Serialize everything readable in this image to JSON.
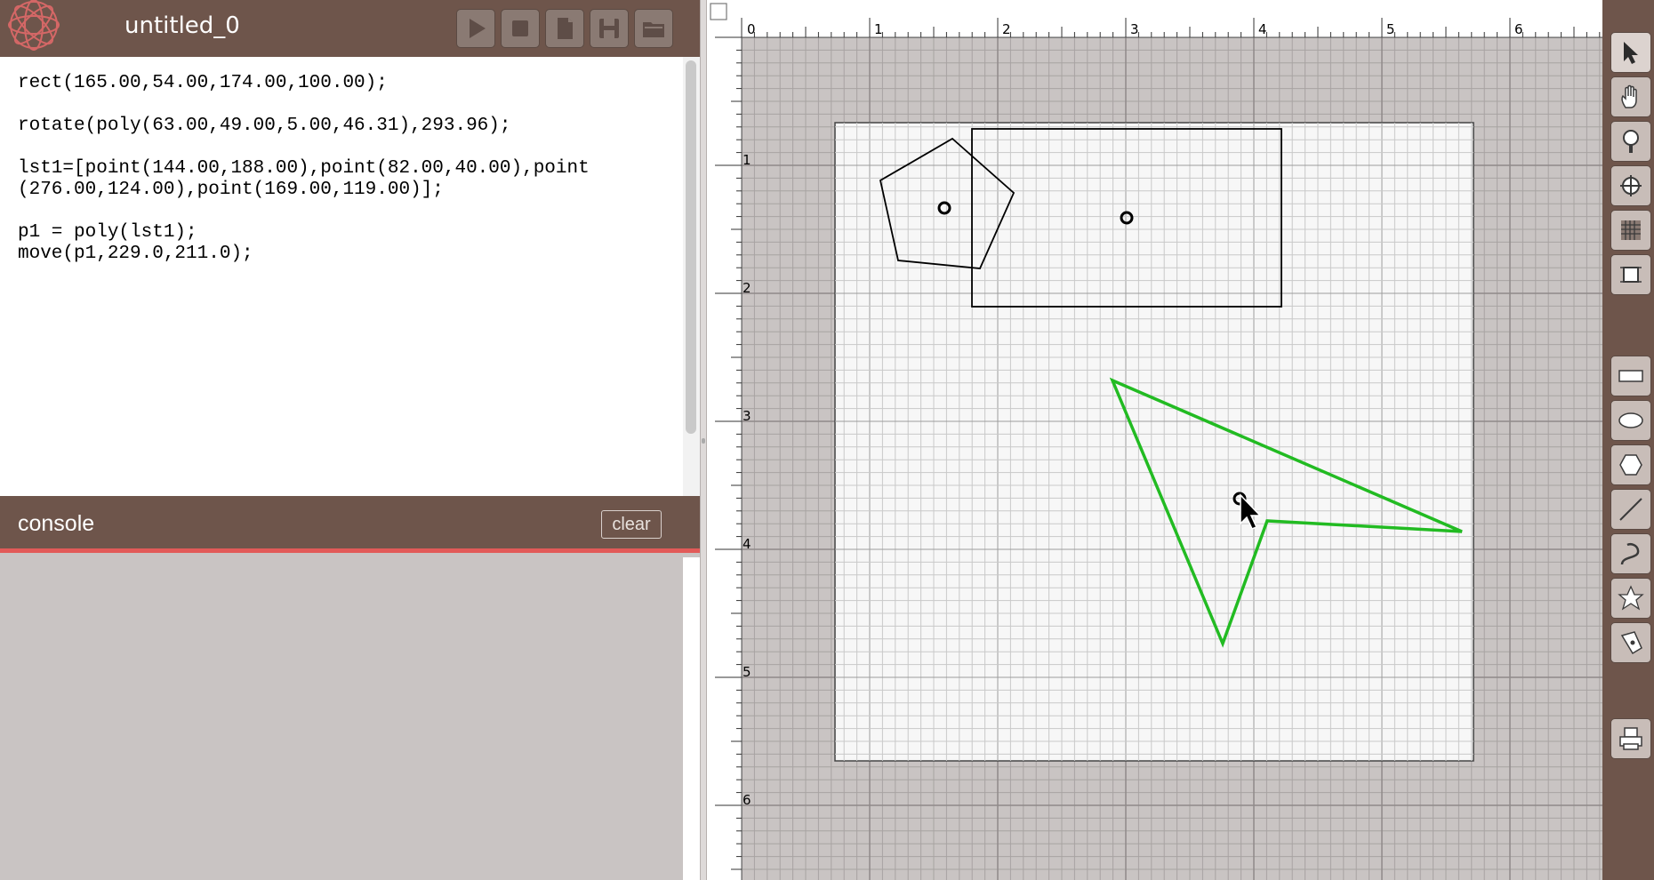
{
  "window": {
    "doc_title": "untitled_0"
  },
  "toolbar_top": [
    {
      "name": "run-button",
      "icon": "play-icon"
    },
    {
      "name": "stop-button",
      "icon": "stop-icon"
    },
    {
      "name": "new-file-button",
      "icon": "new-file-icon"
    },
    {
      "name": "save-button",
      "icon": "save-icon"
    },
    {
      "name": "open-button",
      "icon": "folder-icon"
    }
  ],
  "editor": {
    "lines": [
      "rect(165.00,54.00,174.00,100.00);",
      "",
      "rotate(poly(63.00,49.00,5.00,46.31),293.96);",
      "",
      "lst1=[point(144.00,188.00),point(82.00,40.00),point",
      "(276.00,124.00),point(169.00,119.00)];",
      "",
      "p1 = poly(lst1);",
      "move(p1,229.0,211.0);"
    ]
  },
  "console": {
    "title": "console",
    "clear_label": "clear",
    "accent_color": "#e25a58"
  },
  "ruler": {
    "x_labels": [
      "0",
      "1",
      "2",
      "3",
      "4",
      "5",
      "6"
    ],
    "y_labels": [
      "1",
      "2",
      "3",
      "4",
      "5",
      "6"
    ]
  },
  "shapes": {
    "stroke_default": "#000000",
    "stroke_selected": "#22bb22"
  },
  "toolbar_right": [
    {
      "name": "select-tool",
      "icon": "arrow-cursor-icon",
      "active": true
    },
    {
      "name": "pan-tool",
      "icon": "hand-icon"
    },
    {
      "name": "zoom-tool",
      "icon": "magnifier-icon"
    },
    {
      "name": "target-tool",
      "icon": "crosshair-icon"
    },
    {
      "name": "grid-tool",
      "icon": "grid-icon"
    },
    {
      "name": "crop-tool",
      "icon": "crop-icon"
    },
    {
      "name": "rect-tool",
      "icon": "rectangle-icon"
    },
    {
      "name": "ellipse-tool",
      "icon": "ellipse-icon"
    },
    {
      "name": "polygon-tool",
      "icon": "hexagon-icon"
    },
    {
      "name": "line-tool",
      "icon": "line-icon"
    },
    {
      "name": "curve-tool",
      "icon": "curve-icon"
    },
    {
      "name": "star-tool",
      "icon": "star-icon"
    },
    {
      "name": "pen-tool",
      "icon": "pen-icon"
    },
    {
      "name": "print-tool",
      "icon": "printer-icon"
    }
  ],
  "colors": {
    "header_bg": "#6e554b",
    "panel_bg": "#c9c4c3",
    "grid_line": "#8f8a89"
  }
}
